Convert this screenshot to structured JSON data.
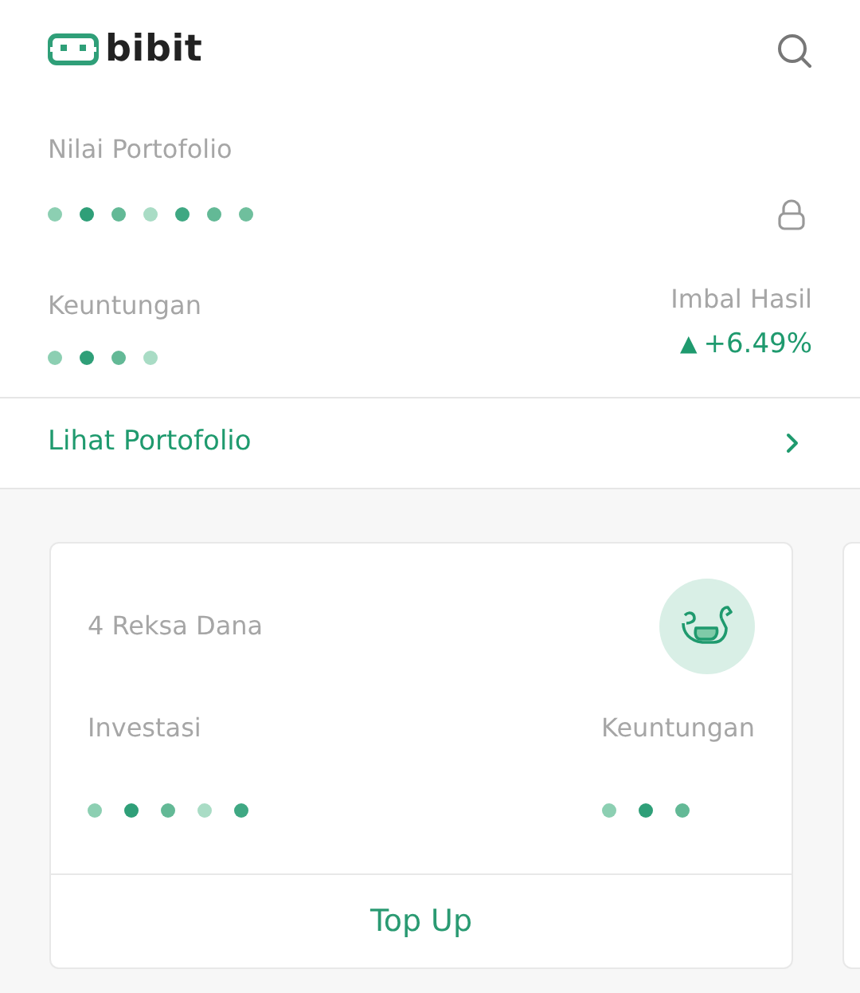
{
  "header": {
    "brand": "bibit"
  },
  "portfolio": {
    "value_label": "Nilai Portofolio",
    "value_dots": [
      {
        "color": "#8ccfb2"
      },
      {
        "color": "#2f9f78"
      },
      {
        "color": "#63b996"
      },
      {
        "color": "#a9dcc5"
      },
      {
        "color": "#3fa883"
      },
      {
        "color": "#63b996"
      },
      {
        "color": "#6fbf9d"
      }
    ],
    "profit_label": "Keuntungan",
    "profit_dots": [
      {
        "color": "#8ccfb2"
      },
      {
        "color": "#2f9f78"
      },
      {
        "color": "#63b996"
      },
      {
        "color": "#a9dcc5"
      }
    ],
    "return_label": "Imbal Hasil",
    "return_arrow": "▲",
    "return_value": "+6.49%"
  },
  "view_link": "Lihat Portofolio",
  "cards": [
    {
      "title": "4 Reksa Dana",
      "invest_label": "Investasi",
      "invest_dots": [
        {
          "color": "#8ccfb2"
        },
        {
          "color": "#2f9f78"
        },
        {
          "color": "#63b996"
        },
        {
          "color": "#a9dcc5"
        },
        {
          "color": "#3fa883"
        }
      ],
      "profit_label": "Keuntungan",
      "profit_dots": [
        {
          "color": "#8ccfb2"
        },
        {
          "color": "#2f9f78"
        },
        {
          "color": "#63b996"
        }
      ],
      "action": "Top Up"
    }
  ]
}
